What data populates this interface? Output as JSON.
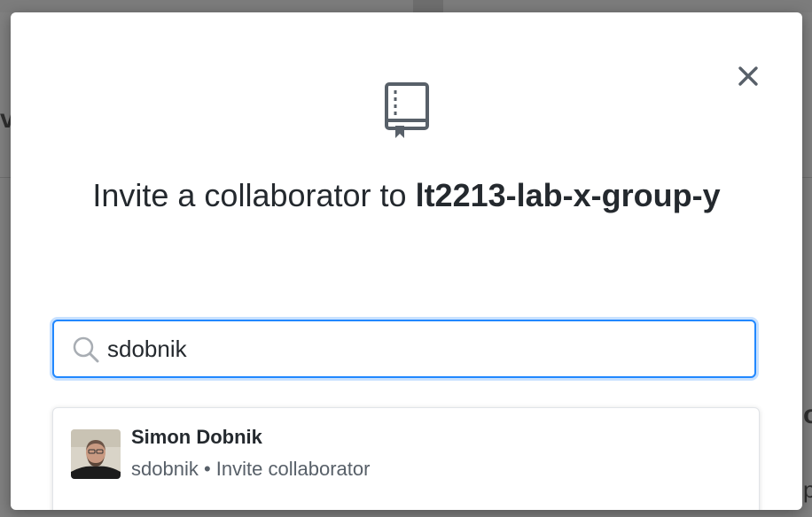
{
  "dialog": {
    "title_prefix": "Invite a collaborator to ",
    "repo_name": "lt2213-lab-x-group-y",
    "close_icon": "close-icon",
    "repo_icon": "repo-book-icon"
  },
  "search": {
    "value": "sdobnik",
    "icon": "search-icon"
  },
  "results": [
    {
      "name": "Simon Dobnik",
      "username": "sdobnik",
      "separator": "•",
      "action": "Invite collaborator"
    }
  ],
  "background": {
    "left_glyph": "v",
    "right_glyph": "o",
    "right_glyph2": "p"
  },
  "colors": {
    "focus_border": "#2188ff",
    "text_primary": "#24292e",
    "text_secondary": "#586069"
  }
}
